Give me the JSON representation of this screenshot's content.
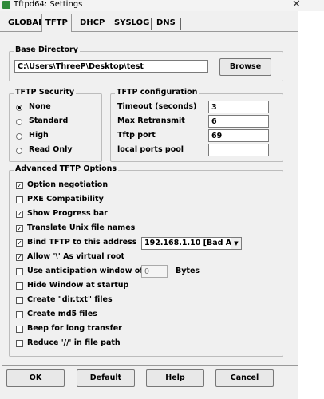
{
  "window": {
    "title": "Tftpd64: Settings"
  },
  "tabs": [
    "GLOBAL",
    "TFTP",
    "DHCP",
    "SYSLOG",
    "DNS"
  ],
  "base_directory": {
    "legend": "Base Directory",
    "value": "C:\\Users\\ThreeP\\Desktop\\test",
    "browse_label": "Browse"
  },
  "tftp_security": {
    "legend": "TFTP Security",
    "options": [
      "None",
      "Standard",
      "High",
      "Read Only"
    ],
    "selected": "None"
  },
  "tftp_configuration": {
    "legend": "TFTP configuration",
    "fields": [
      {
        "label": "Timeout (seconds)",
        "value": "3"
      },
      {
        "label": "Max Retransmit",
        "value": "6"
      },
      {
        "label": "Tftp port",
        "value": "69"
      },
      {
        "label": "local ports pool",
        "value": ""
      }
    ]
  },
  "advanced": {
    "legend": "Advanced TFTP Options",
    "options": [
      {
        "label": "Option negotiation",
        "checked": true
      },
      {
        "label": "PXE Compatibility",
        "checked": false
      },
      {
        "label": "Show Progress bar",
        "checked": true
      },
      {
        "label": "Translate Unix file names",
        "checked": true
      },
      {
        "label": "Bind TFTP to this address",
        "checked": true
      },
      {
        "label": "Allow '\\' As virtual root",
        "checked": true
      },
      {
        "label": "Use anticipation window of",
        "checked": false
      },
      {
        "label": "Hide Window at startup",
        "checked": false
      },
      {
        "label": "Create \"dir.txt\" files",
        "checked": false
      },
      {
        "label": "Create md5 files",
        "checked": false
      },
      {
        "label": "Beep for long transfer",
        "checked": false
      },
      {
        "label": "Reduce '//' in file path",
        "checked": false
      }
    ],
    "bind_address": "192.168.1.10 [Bad Add",
    "anticipation_value": "0",
    "anticipation_unit": "Bytes"
  },
  "buttons": {
    "ok": "OK",
    "default": "Default",
    "help": "Help",
    "cancel": "Cancel"
  }
}
